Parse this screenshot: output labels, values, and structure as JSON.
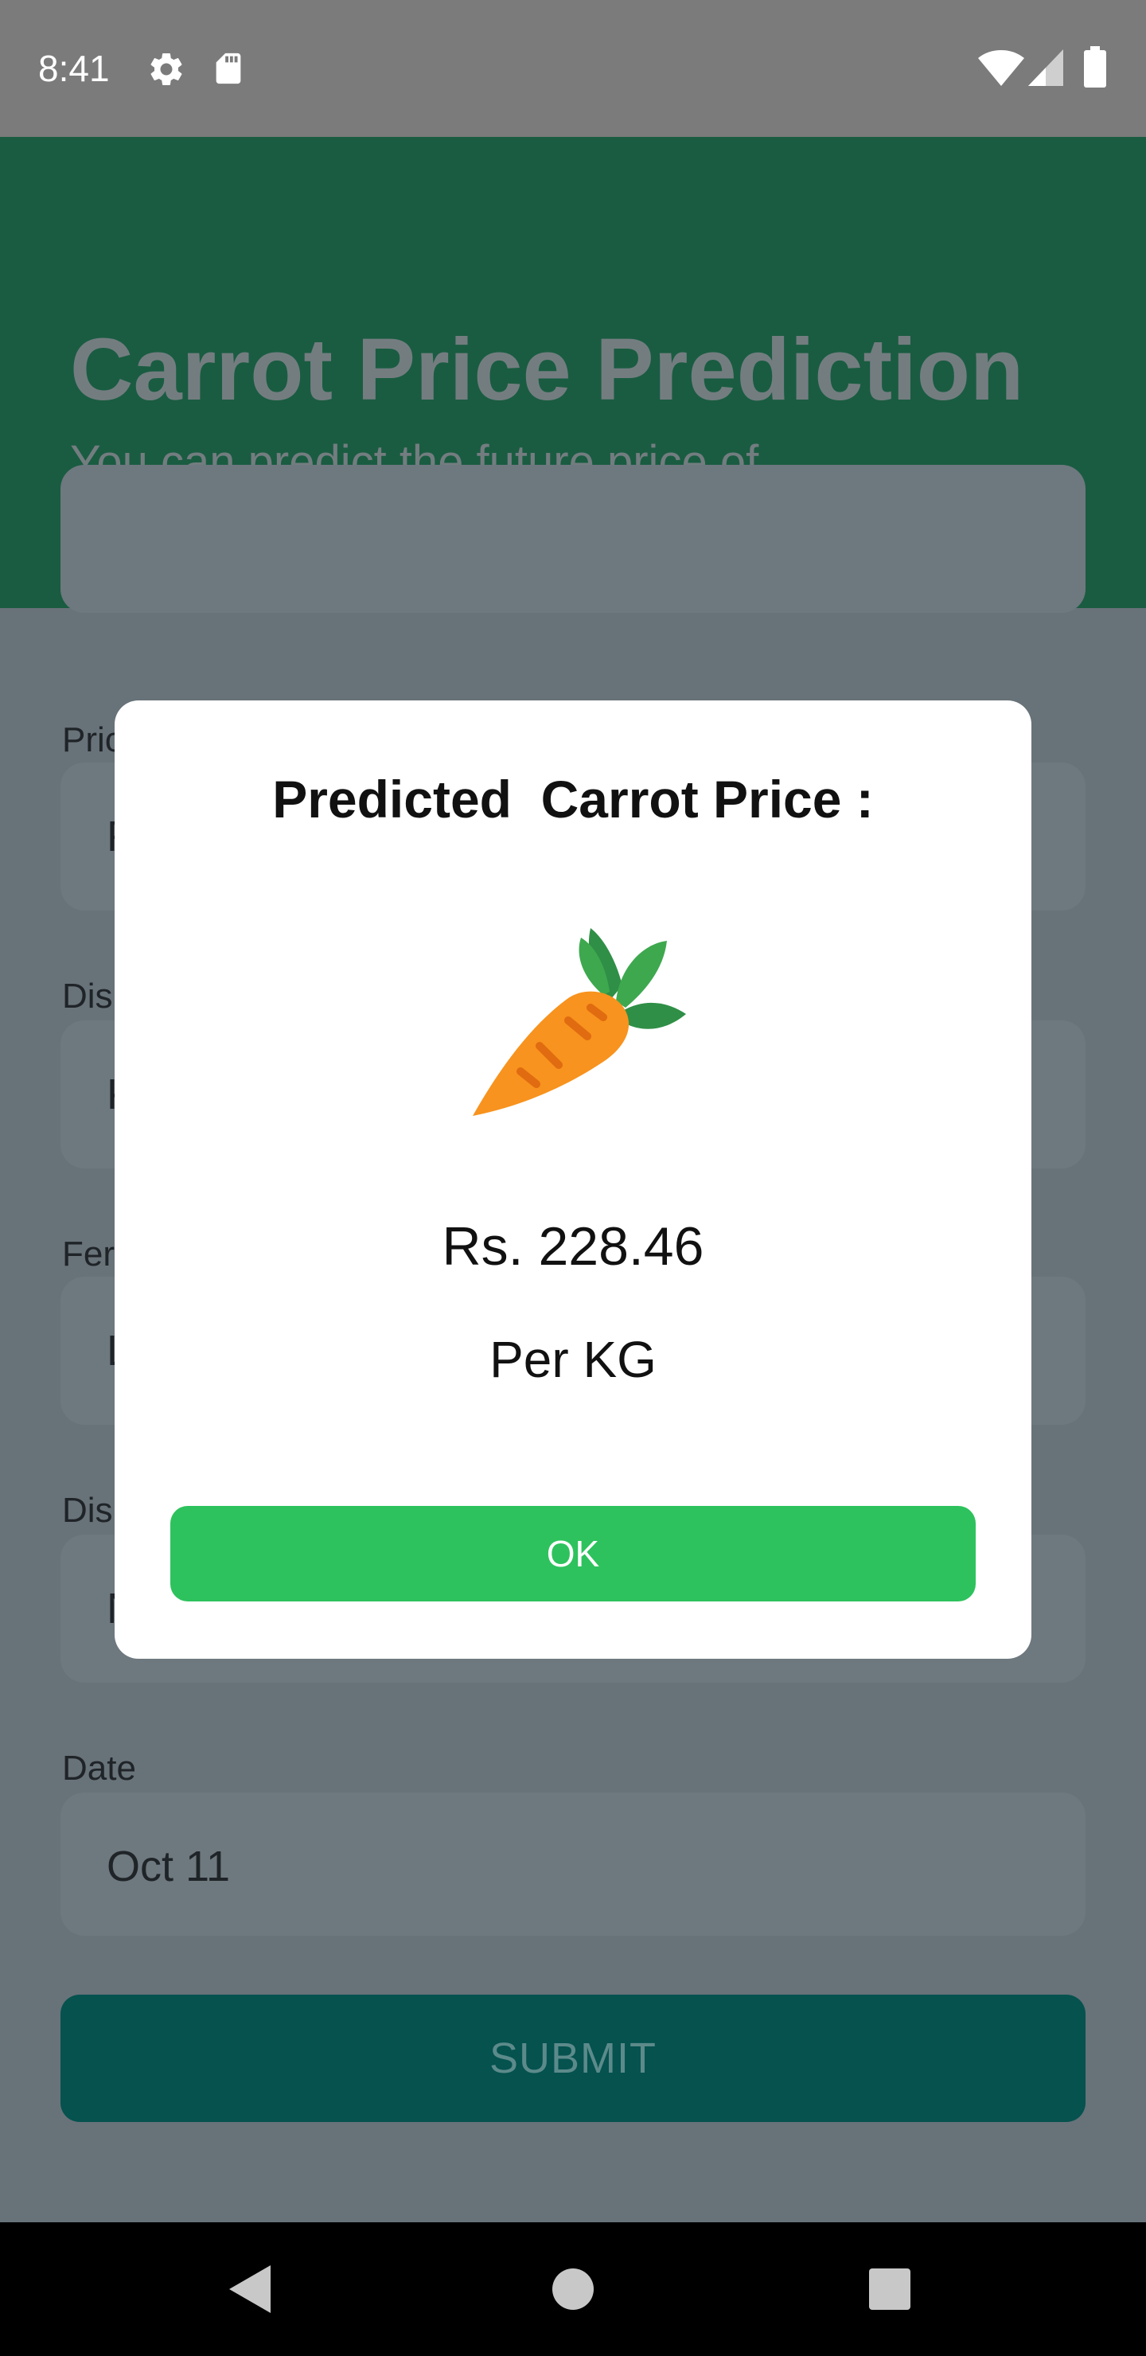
{
  "status_bar": {
    "time": "8:41",
    "left_icons": [
      "gear-icon",
      "sd-card-icon"
    ],
    "right_icons": [
      "wifi-icon",
      "cell-signal-icon",
      "battery-icon"
    ]
  },
  "header": {
    "title": "Carrot Price Prediction",
    "subtitle": "You can predict the future price of vegetables through this",
    "color": "#1a5c41"
  },
  "form": {
    "fields": [
      {
        "label": "Pric",
        "value": "F"
      },
      {
        "label": "Dis",
        "value": "K"
      },
      {
        "label": "Fer",
        "value": "L"
      },
      {
        "label": "Dis",
        "value": "N"
      },
      {
        "label": "Date",
        "value": "Oct 11"
      }
    ],
    "submit_label": "SUBMIT"
  },
  "dialog": {
    "title": "Predicted  Carrot Price :",
    "image_icon": "carrot-icon",
    "price": "Rs. 228.46",
    "unit": "Per KG",
    "ok_label": "OK",
    "ok_color": "#2dc25d"
  },
  "nav_bar": {
    "icons": [
      "back-icon",
      "home-icon",
      "recents-icon"
    ]
  }
}
